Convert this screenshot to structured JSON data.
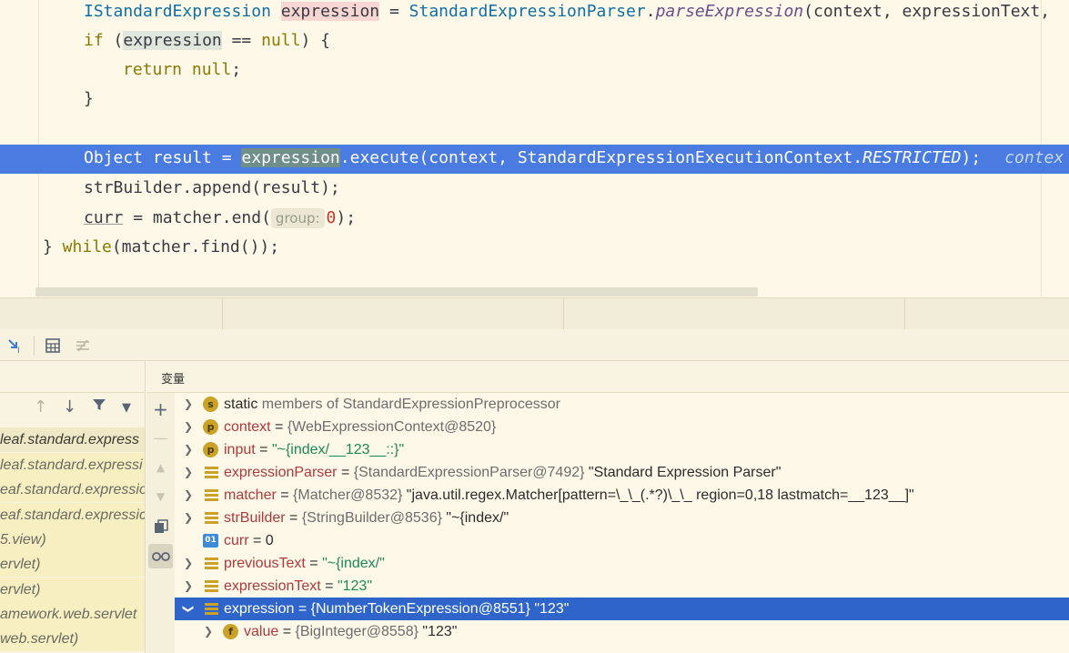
{
  "editor": {
    "lines": [
      {
        "t1": "IStandardExpression ",
        "t2": "expression",
        "t3": " = ",
        "t4": "StandardExpressionParser",
        "t5": ".",
        "t6": "parseExpression",
        "t7": "(context, expressionText,"
      },
      {
        "t1": "if",
        "t2": " (",
        "t3": "expression",
        "t4": " == ",
        "t5": "null",
        "t6": ") {"
      },
      {
        "t1": "return",
        "t2": " ",
        "t3": "null",
        "t4": ";"
      },
      {
        "t1": "}"
      },
      {
        "t1": "Object result = ",
        "t2": "expression",
        "t3": ".execute(context, StandardExpressionExecutionContext.",
        "t4": "RESTRICTED",
        "t5": ");",
        "t6": "contex"
      },
      {
        "t1": "strBuilder.append(result);"
      },
      {
        "t1": "curr",
        "t2": " = matcher.end(",
        "t3": "group:",
        "t4": "0",
        "t5": ");"
      },
      {
        "t1": "}",
        "t2": " while",
        "t3": "(matcher.find());"
      }
    ]
  },
  "debug_toolbar": {
    "icons": [
      "show-execution-point-icon",
      "evaluate-expression-icon",
      "trace-stream-icon"
    ]
  },
  "frames": {
    "tools": [
      "up-arrow-icon",
      "down-arrow-icon",
      "filter-icon",
      "chevron-down-icon"
    ],
    "items": [
      "leaf.standard.express",
      "leaf.standard.expressi",
      "eaf.standard.expressio",
      "eaf.standard.expressic",
      "5.view)",
      "ervlet)",
      "amework.web.servlet",
      "web.servlet)"
    ]
  },
  "variables": {
    "title": "变量",
    "side_tools": [
      "plus-icon",
      "minus-icon",
      "up-icon",
      "down-icon",
      "copy-icon",
      "glasses-icon"
    ],
    "rows": [
      {
        "icon": "s",
        "name": "static",
        "rest": " members of StandardExpressionPreprocessor"
      },
      {
        "icon": "p",
        "name": "context",
        "eq": " = ",
        "ref": "{WebExpressionContext@8520}",
        "val": ""
      },
      {
        "icon": "p",
        "name": "input",
        "eq": " = ",
        "ref": "",
        "val": "\"~{index/__123__::}\""
      },
      {
        "icon": "fld",
        "name": "expressionParser",
        "eq": " = ",
        "ref": "{StandardExpressionParser@7492}",
        "val": " \"Standard Expression Parser\""
      },
      {
        "icon": "fld",
        "name": "matcher",
        "eq": " = ",
        "ref": "{Matcher@8532}",
        "val": " \"java.util.regex.Matcher[pattern=\\_\\_(.*?)\\_\\_ region=0,18 lastmatch=__123__]\""
      },
      {
        "icon": "fld",
        "name": "strBuilder",
        "eq": " = ",
        "ref": "{StringBuilder@8536}",
        "val": " \"~{index/\""
      },
      {
        "icon": "prim",
        "iconText": "01",
        "name": "curr",
        "eq": " = ",
        "ref": "",
        "val": "0"
      },
      {
        "icon": "fld",
        "name": "previousText",
        "eq": " = ",
        "ref": "",
        "val": "\"~{index/\""
      },
      {
        "icon": "fld",
        "name": "expressionText",
        "eq": " = ",
        "ref": "",
        "val": "\"123\""
      },
      {
        "icon": "fld",
        "name": "expression",
        "eq": " = ",
        "ref": "{NumberTokenExpression@8551}",
        "val": " \"123\""
      },
      {
        "icon": "f",
        "iconText": "f",
        "name": "value",
        "eq": " = ",
        "ref": "{BigInteger@8558}",
        "val": " \"123\""
      }
    ]
  }
}
